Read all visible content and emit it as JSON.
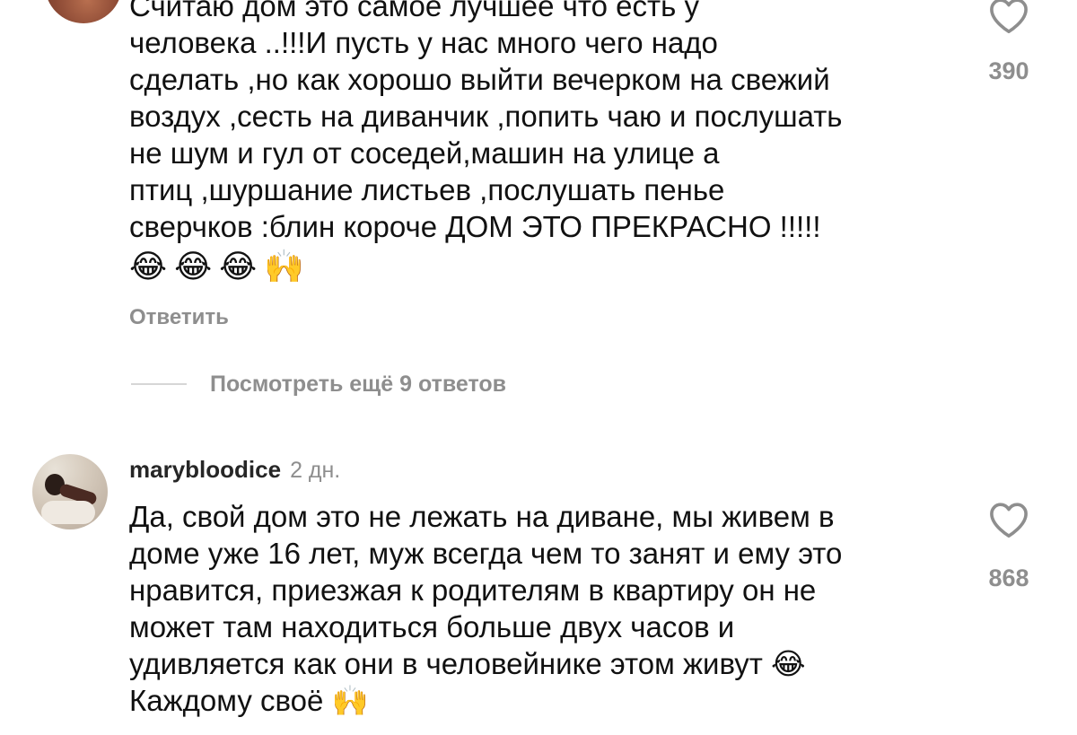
{
  "comments": [
    {
      "lines": [
        "Считаю дом это самое лучшее что есть у",
        "человека ..!!!И пусть у нас много чего надо",
        "сделать ,но как хорошо выйти вечерком на свежий",
        "воздух ,сесть на диванчик ,попить чаю и послушать",
        "не шум и гул от соседей,машин на улице а",
        "птиц ,шуршание листьев ,послушать пенье",
        "сверчков :блин короче ДОМ ЭТО ПРЕКРАСНО !!!!!"
      ],
      "emojis": [
        "😂",
        "😂",
        "😂",
        "🙌"
      ],
      "likes": "390",
      "like_icon": "heart-icon",
      "reply_label": "Ответить",
      "view_more_label": "Посмотреть ещё 9 ответов"
    },
    {
      "username": "marybloodice",
      "time": "2 дн.",
      "lines": [
        "Да, свой дом это не лежать на диване, мы живем в",
        "доме уже 16 лет, муж всегда чем то занят и ему это",
        "нравится, приезжая к родителям в квартиру он не",
        "может там находиться больше двух часов и",
        "удивляется как они в человейнике этом живут 😂",
        "Каждому своё 🙌"
      ],
      "likes": "868",
      "like_icon": "heart-icon"
    }
  ],
  "colors": {
    "text": "#111111",
    "secondary": "#8e8e8e",
    "divider": "#d6d6d6"
  }
}
